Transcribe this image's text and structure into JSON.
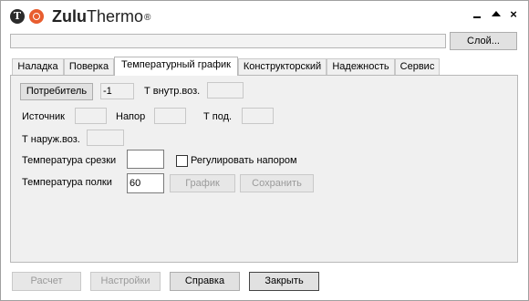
{
  "app": {
    "name_bold": "Zulu",
    "name_rest": "Thermo",
    "reg_mark": "®",
    "logo_letter": "T"
  },
  "window_controls": {
    "close": "×"
  },
  "layer": {
    "path": "",
    "button_label": "Слой..."
  },
  "tabs": [
    {
      "label": "Наладка",
      "active": false
    },
    {
      "label": "Поверка",
      "active": false
    },
    {
      "label": "Температурный график",
      "active": true
    },
    {
      "label": "Конструкторский",
      "active": false
    },
    {
      "label": "Надежность",
      "active": false
    },
    {
      "label": "Сервис",
      "active": false
    }
  ],
  "form": {
    "consumer_button": "Потребитель",
    "consumer_id": "-1",
    "t_inner_label": "Т внутр.воз.",
    "t_inner_value": "",
    "source_label": "Источник",
    "source_value": "",
    "head_label": "Напор",
    "head_value": "",
    "t_supply_label": "Т под.",
    "t_supply_value": "",
    "t_outer_label": "Т наруж.воз.",
    "t_outer_value": "",
    "cutoff_label": "Температура срезки",
    "cutoff_value": "",
    "regulate_label": "Регулировать напором",
    "regulate_checked": false,
    "shelf_label": "Температура полки",
    "shelf_value": "60",
    "graph_button": "График",
    "save_button": "Сохранить"
  },
  "footer": {
    "calc": "Расчет",
    "settings": "Настройки",
    "help": "Справка",
    "close": "Закрыть"
  }
}
